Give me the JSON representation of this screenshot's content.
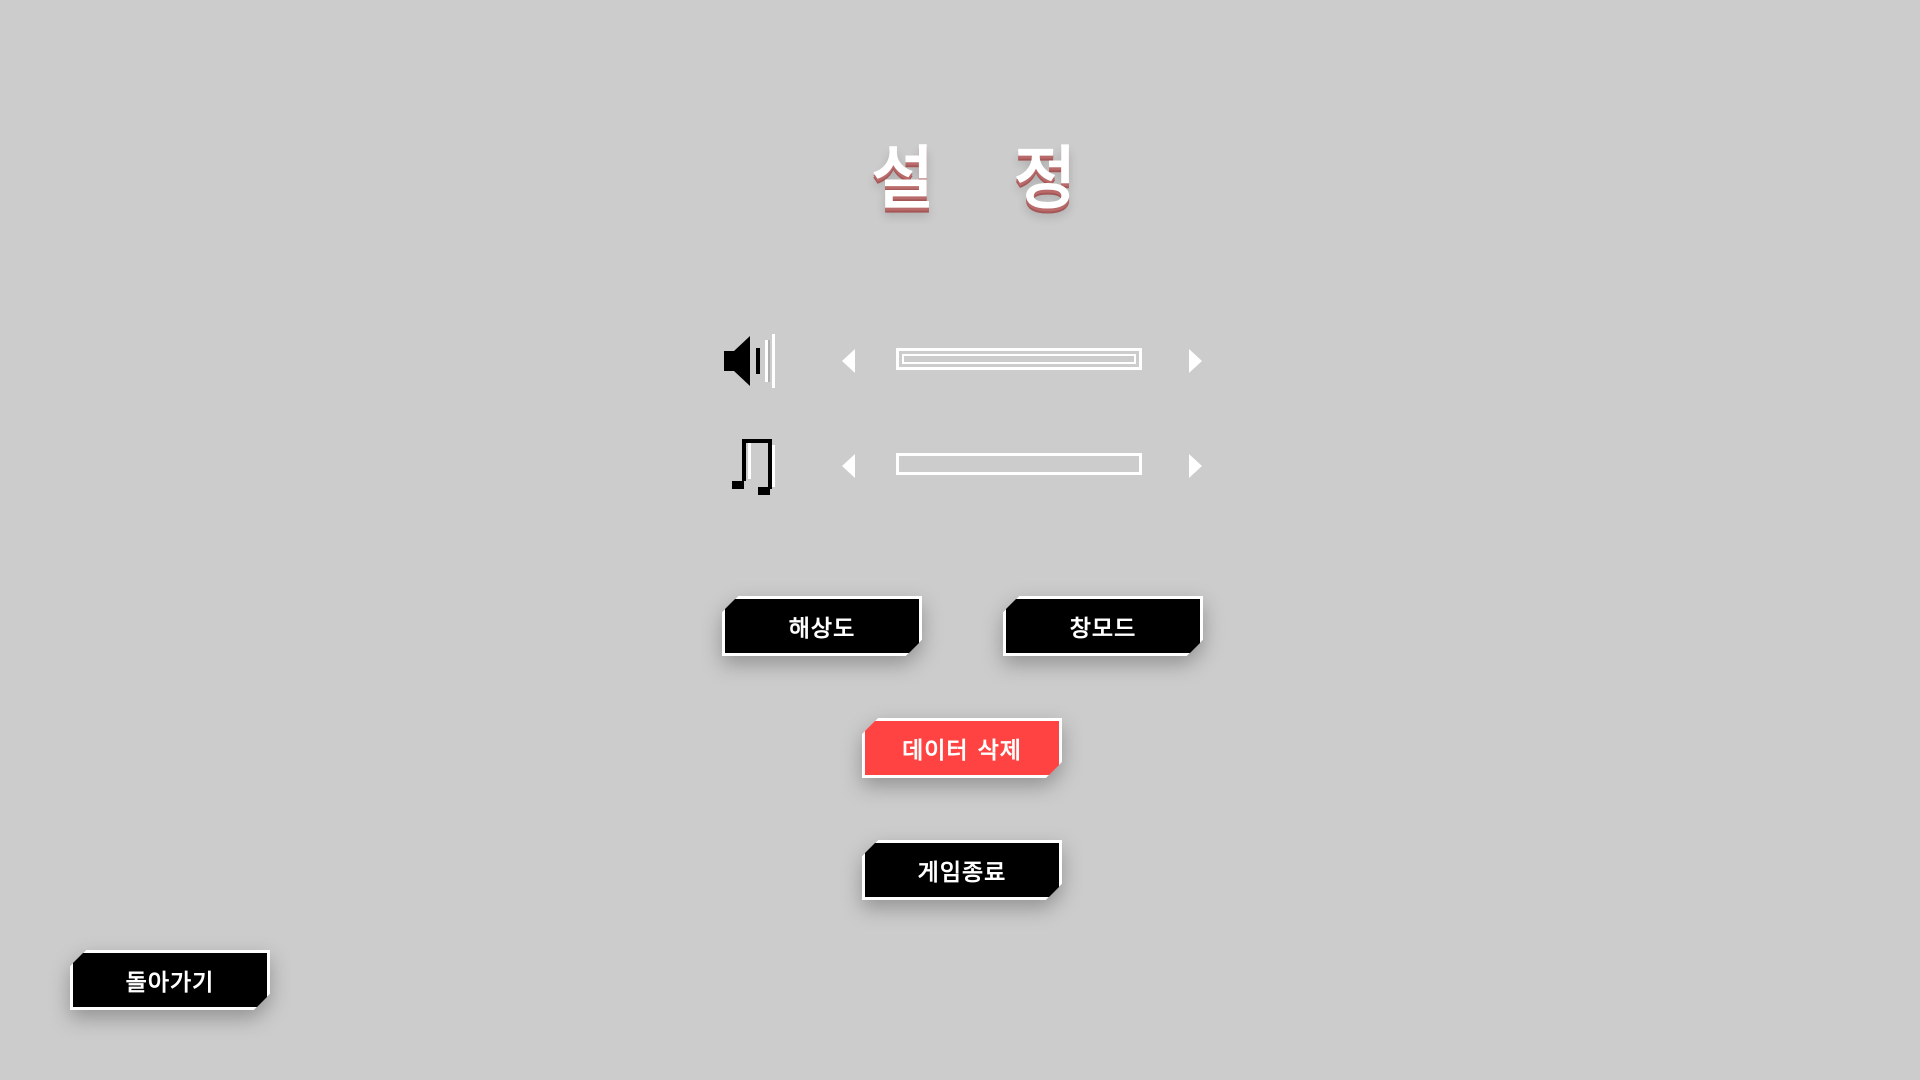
{
  "title": "설 정",
  "audio": {
    "sfx": {
      "icon": "speaker-volume-icon",
      "level": 1.0
    },
    "music": {
      "icon": "music-note-icon",
      "level": 0.0
    }
  },
  "buttons": {
    "resolution": "해상도",
    "window_mode": "창모드",
    "delete_data": "데이터 삭제",
    "quit_game": "게임종료",
    "back": "돌아가기"
  },
  "colors": {
    "background": "#cccccc",
    "button": "#000000",
    "danger_button": "#ff4343",
    "text": "#ffffff"
  }
}
